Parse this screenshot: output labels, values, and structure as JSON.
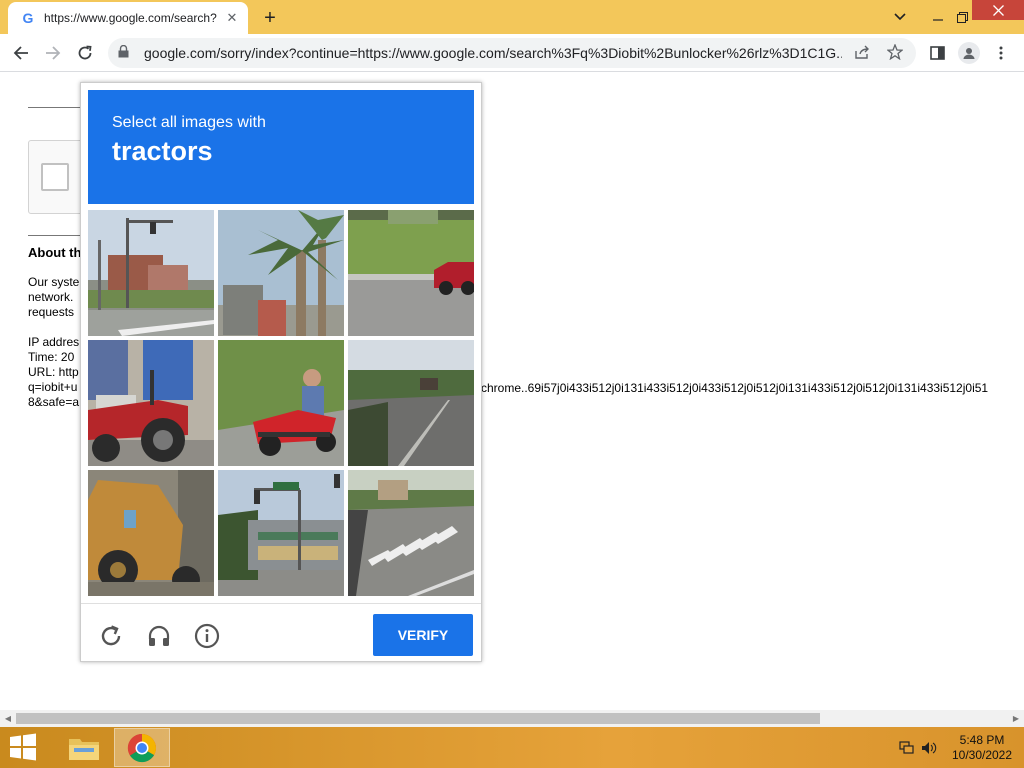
{
  "browser": {
    "tab_title": "https://www.google.com/search?",
    "tab_favicon": "G",
    "new_tab": "+",
    "tab_list_icon": "chevron-down-icon",
    "url": "google.com/sorry/index?continue=https://www.google.com/search%3Fq%3Diobit%2Bunlocker%26rlz%3D1C1G...",
    "accent_color": "#f3c75a"
  },
  "page": {
    "about_heading": "About th",
    "para1_line1": "Our syste",
    "para1_line2": "network.",
    "para1_line3": "requests",
    "ip_line": "IP addres",
    "time_line": "Time: 20",
    "url_line": "URL: http",
    "url_line2": "q=iobit+u",
    "url_line3": "8&safe=a",
    "url_tail": "chrome..69i57j0i433i512j0i131i433i512j0i433i512j0i512j0i131i433i512j0i512j0i131i433i512j0i51"
  },
  "captcha": {
    "instruction": "Select all images with",
    "target": "tractors",
    "verify_label": "VERIFY",
    "header_color": "#1a73e8",
    "tiles": [
      {
        "name": "tile-street-intersection"
      },
      {
        "name": "tile-palm-tree"
      },
      {
        "name": "tile-road-red-car"
      },
      {
        "name": "tile-red-tractor"
      },
      {
        "name": "tile-lawn-mower"
      },
      {
        "name": "tile-road-trees"
      },
      {
        "name": "tile-backhoe"
      },
      {
        "name": "tile-traffic-light-building"
      },
      {
        "name": "tile-crosswalk"
      }
    ]
  },
  "taskbar": {
    "time": "5:48 PM",
    "date": "10/30/2022"
  }
}
